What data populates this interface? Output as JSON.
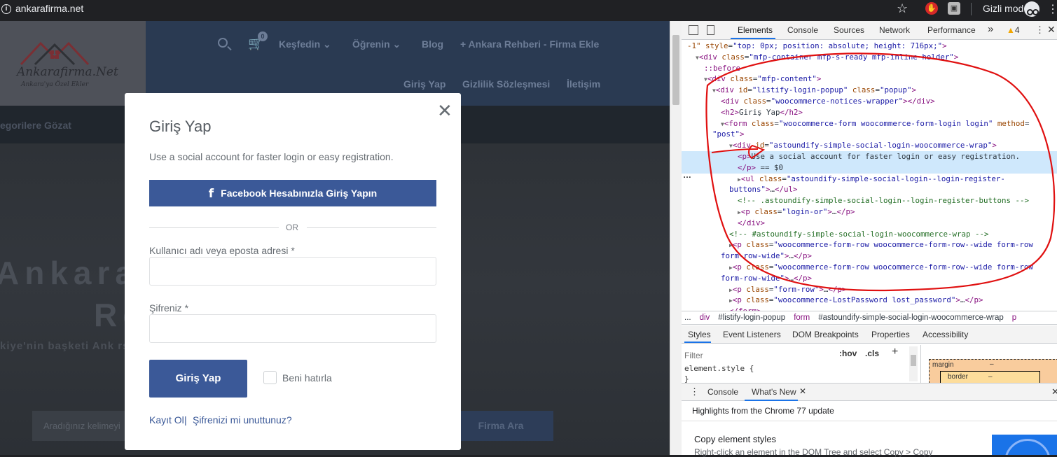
{
  "browser": {
    "url": "ankarafirma.net",
    "incognito_label": "Gizli mod"
  },
  "site": {
    "logo_text": "Ankarafirma.Net",
    "logo_sub": "Ankara'ya Özel Ekler",
    "cart_count": "0",
    "nav": {
      "kesfedin": "Keşfedin",
      "ogrenin": "Öğrenin",
      "blog": "Blog",
      "add_firm": "Ankara Rehberi - Firma Ekle",
      "login": "Giriş Yap",
      "privacy": "Gizlilik Sözleşmesi",
      "contact": "İletişim"
    },
    "categories_link": "egorilere Gözat",
    "hero_title_line1": "Ankara                   e Firma",
    "hero_title_line2": "Re                         m.",
    "hero_subtitle": "kiye'nin başketi Ank                                                          rsa Ankara Rehberi'nde.",
    "search_placeholder": "Aradığınız kelimeyi",
    "search_button": "Firma Ara"
  },
  "modal": {
    "title": "Giriş Yap",
    "description": "Use a social account for faster login or easy registration.",
    "facebook_button": "Facebook Hesabınızla Giriş Yapın",
    "facebook_icon": "f",
    "or_text": "OR",
    "username_label": "Kullanıcı adı veya eposta adresi *",
    "password_label": "Şifreniz *",
    "login_button": "Giriş Yap",
    "remember_label": "Beni hatırla",
    "register_link": "Kayıt Ol",
    "pipe": "|",
    "forgot_link": "Şifrenizi mi unuttunuz?",
    "close_glyph": "✕"
  },
  "devtools": {
    "tabs": [
      "Elements",
      "Console",
      "Sources",
      "Network",
      "Performance"
    ],
    "more_tabs": "»",
    "warnings": "4",
    "dom_lines": [
      {
        "indent": 0,
        "html": "<span class='attr'>-1\"</span> <span class='attr'>style</span>=<span class='val'>\"top: 0px; position: absolute; height: 716px;\"</span><span class='tag'>&gt;</span>"
      },
      {
        "indent": 1,
        "html": "<span class='tri-d'>▼</span><span class='tag'>&lt;div</span> <span class='attr'>class</span>=<span class='val'>\"mfp-container mfp-s-ready mfp-inline-holder\"</span><span class='tag'>&gt;</span>"
      },
      {
        "indent": 2,
        "html": "<span class='tag'>::before</span>"
      },
      {
        "indent": 2,
        "html": "<span class='tri-d'>▼</span><span class='tag'>&lt;div</span> <span class='attr'>class</span>=<span class='val'>\"mfp-content\"</span><span class='tag'>&gt;</span>"
      },
      {
        "indent": 3,
        "html": "<span class='tri-d'>▼</span><span class='tag'>&lt;div</span> <span class='attr'>id</span>=<span class='val'>\"listify-login-popup\"</span> <span class='attr'>class</span>=<span class='val'>\"popup\"</span><span class='tag'>&gt;</span>"
      },
      {
        "indent": 4,
        "html": "<span class='tag'>&lt;div</span> <span class='attr'>class</span>=<span class='val'>\"woocommerce-notices-wrapper\"</span><span class='tag'>&gt;&lt;/div&gt;</span>"
      },
      {
        "indent": 4,
        "html": "<span class='tag'>&lt;h2&gt;</span><span class='txt'>Giriş Yap</span><span class='tag'>&lt;/h2&gt;</span>"
      },
      {
        "indent": 4,
        "html": "<span class='tri-d'>▼</span><span class='tag'>&lt;form</span> <span class='attr'>class</span>=<span class='val'>\"woocommerce-form woocommerce-form-login login\"</span> <span class='attr'>method</span>="
      },
      {
        "indent": 3,
        "html": "<span class='val'>\"post\"</span><span class='tag'>&gt;</span>"
      },
      {
        "indent": 5,
        "html": "<span class='tri-d'>▼</span><span class='tag'>&lt;div</span> <span class='attr'>id</span>=<span class='val'>\"astoundify-simple-social-login-woocommerce-wrap\"</span><span class='tag'>&gt;</span>"
      },
      {
        "indent": 6,
        "html": "<span class='tag'>&lt;p&gt;</span><span class='txt'>Use a social account for faster login or easy registration.</span>",
        "selected": true
      },
      {
        "indent": 6,
        "html": "<span class='tag'>&lt;/p&gt;</span> <span class='txt'>== $0</span>",
        "selected": true
      },
      {
        "indent": 6,
        "html": "<span class='tri-r'>▶</span><span class='tag'>&lt;ul</span> <span class='attr'>class</span>=<span class='val'>\"astoundify-simple-social-login--login-register-</span>"
      },
      {
        "indent": 5,
        "html": "<span class='val'>buttons\"</span><span class='tag'>&gt;</span>…<span class='tag'>&lt;/ul&gt;</span>"
      },
      {
        "indent": 6,
        "html": "<span class='cmt'>&lt;!-- .astoundify-simple-social-login--login-register-buttons --&gt;</span>"
      },
      {
        "indent": 6,
        "html": "<span class='tri-r'>▶</span><span class='tag'>&lt;p</span> <span class='attr'>class</span>=<span class='val'>\"login-or\"</span><span class='tag'>&gt;</span>…<span class='tag'>&lt;/p&gt;</span>"
      },
      {
        "indent": 6,
        "html": "<span class='tag'>&lt;/div&gt;</span>"
      },
      {
        "indent": 5,
        "html": "<span class='cmt'>&lt;!-- #astoundify-simple-social-login-woocommerce-wrap --&gt;</span>"
      },
      {
        "indent": 5,
        "html": "<span class='tri-r'>▶</span><span class='tag'>&lt;p</span> <span class='attr'>class</span>=<span class='val'>\"woocommerce-form-row woocommerce-form-row--wide form-row</span>"
      },
      {
        "indent": 4,
        "html": "<span class='val'>form-row-wide\"</span><span class='tag'>&gt;</span>…<span class='tag'>&lt;/p&gt;</span>"
      },
      {
        "indent": 5,
        "html": "<span class='tri-r'>▶</span><span class='tag'>&lt;p</span> <span class='attr'>class</span>=<span class='val'>\"woocommerce-form-row woocommerce-form-row--wide form-row</span>"
      },
      {
        "indent": 4,
        "html": "<span class='val'>form-row-wide\"</span><span class='tag'>&gt;</span>…<span class='tag'>&lt;/p&gt;</span>"
      },
      {
        "indent": 5,
        "html": "<span class='tri-r'>▶</span><span class='tag'>&lt;p</span> <span class='attr'>class</span>=<span class='val'>\"form-row\"</span><span class='tag'>&gt;</span>…<span class='tag'>&lt;/p&gt;</span>"
      },
      {
        "indent": 5,
        "html": "<span class='tri-r'>▶</span><span class='tag'>&lt;p</span> <span class='attr'>class</span>=<span class='val'>\"woocommerce-LostPassword lost_password\"</span><span class='tag'>&gt;</span>…<span class='tag'>&lt;/p&gt;</span>"
      },
      {
        "indent": 5,
        "html": "<span class='tag'>&lt;/form&gt;</span>"
      }
    ],
    "breadcrumbs": [
      "...",
      "div",
      "#listify-login-popup",
      "form",
      "#astoundify-simple-social-login-woocommerce-wrap",
      "p"
    ],
    "styles_tabs": [
      "Styles",
      "Event Listeners",
      "DOM Breakpoints",
      "Properties",
      "Accessibility"
    ],
    "filter_placeholder": "Filter",
    "hov": ":hov",
    "cls": ".cls",
    "element_style": "element.style {",
    "element_style_close": "}",
    "box_margin_label": "margin",
    "box_border_label": "border",
    "box_dash": "–",
    "drawer_tabs": [
      "Console",
      "What's New"
    ],
    "highlights": "Highlights from the Chrome 77 update",
    "copy_title": "Copy element styles",
    "copy_desc": "Right-click an element in the DOM Tree and select Copy > Copy"
  },
  "colors": {
    "brand_blue": "#3b5998",
    "devtools_accent": "#1a73e8",
    "annotation_red": "#e01010"
  }
}
